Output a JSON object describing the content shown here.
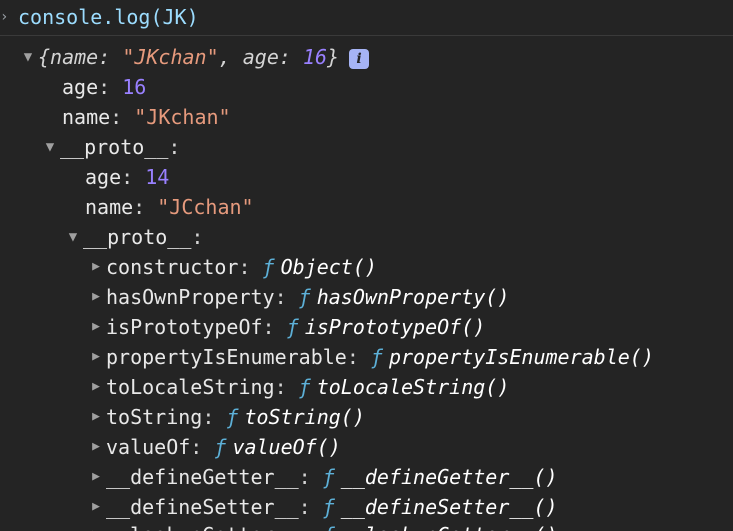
{
  "input": {
    "prompt_icon": "chevron-right-icon",
    "command": "console.log(JK)"
  },
  "preview": {
    "open": "{",
    "key1": "name",
    "sep": ": ",
    "val1": "\"JKchan\"",
    "comma": ", ",
    "key2": "age",
    "val2": "16",
    "close": "}",
    "badge": "i"
  },
  "rows": {
    "age": {
      "key": "age",
      "value": "16"
    },
    "name": {
      "key": "name",
      "value": "\"JKchan\""
    },
    "proto1": {
      "key": "__proto__"
    },
    "proto1_age": {
      "key": "age",
      "value": "14"
    },
    "proto1_name": {
      "key": "name",
      "value": "\"JCchan\""
    },
    "proto2": {
      "key": "__proto__"
    }
  },
  "colon": ":",
  "f_symbol": "ƒ",
  "methods": [
    {
      "key": "constructor",
      "fn": "Object()"
    },
    {
      "key": "hasOwnProperty",
      "fn": "hasOwnProperty()"
    },
    {
      "key": "isPrototypeOf",
      "fn": "isPrototypeOf()"
    },
    {
      "key": "propertyIsEnumerable",
      "fn": "propertyIsEnumerable()"
    },
    {
      "key": "toLocaleString",
      "fn": "toLocaleString()"
    },
    {
      "key": "toString",
      "fn": "toString()"
    },
    {
      "key": "valueOf",
      "fn": "valueOf()"
    },
    {
      "key": "__defineGetter__",
      "fn": "__defineGetter__()"
    },
    {
      "key": "__defineSetter__",
      "fn": "__defineSetter__()"
    },
    {
      "key": "__lookupGetter__",
      "fn": "__lookupGetter__()"
    }
  ],
  "colors": {
    "background": "#242424",
    "key": "#e8e8e8",
    "number": "#9980ff",
    "string": "#e69a7d",
    "function_symbol": "#5db0d7"
  }
}
